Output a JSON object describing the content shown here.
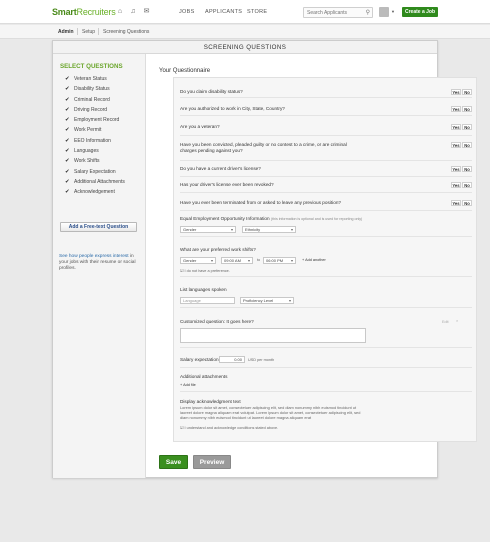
{
  "brand": {
    "part1": "Smart",
    "part2": "Recruiters",
    "accent": "#6bb12a",
    "dark_accent": "#2f8a1c"
  },
  "nav": {
    "icons": [
      "home-icon",
      "bell-icon",
      "mail-icon"
    ],
    "links": [
      "JOBS",
      "APPLICANTS",
      "STORE"
    ],
    "search_placeholder": "Search Applicants",
    "create_label": "Create a Job"
  },
  "subnav": {
    "admin": "Admin",
    "setup": "Setup",
    "screening": "Screening Questions"
  },
  "card": {
    "title": "SCREENING QUESTIONS"
  },
  "sidebar": {
    "title": "SELECT QUESTIONS",
    "items": [
      "Veteran Status",
      "Disability Status",
      "Criminal Record",
      "Driving Record",
      "Employment Record",
      "Work Permit",
      "EEO Information",
      "Languages",
      "Work Shifts",
      "Salary Expectation",
      "Additional Attachments",
      "Acknowledgement"
    ],
    "add_free_text": "Add a Free-text Question",
    "note_link": "See how people express interest",
    "note_rest": " in your jobs with their resume or social profiles."
  },
  "content": {
    "title": "Your Questionnaire",
    "yes": "Yes",
    "no": "No",
    "questions": [
      "Do you claim disability status?",
      "Are you authorized to work in City, State, Country?",
      "Are you a veteran?",
      "Have you been convicted, pleaded guilty or no contest to a crime, or are criminal charges pending against you?",
      "Do you have a current driver's license?",
      "Has your driver's license ever been revoked?",
      "Have you ever been terminated from or asked to leave any previous position?"
    ],
    "eeo": {
      "label": "Equal Employment Opportunity Information",
      "hint": "(this information is optional and is used for reporting only)",
      "gender": "Gender",
      "ethnicity": "Ethnicity"
    },
    "shifts": {
      "label": "What are your preferred work shifts?",
      "gender": "Gender",
      "from": "09:00 AM",
      "to_label": "to",
      "to": "06:00 PM",
      "add": "+ Add another",
      "no_pref": "I do not have a preference."
    },
    "languages": {
      "label": "List languages spoken",
      "placeholder": "Language",
      "level": "Proficiency Level"
    },
    "custom": {
      "label": "Customized question: It goes here?",
      "edit": "Edit",
      "close": "×"
    },
    "salary": {
      "label": "Salary expectation",
      "value": "0.00",
      "suffix": "USD per month"
    },
    "attachments": {
      "label": "Additional attachments",
      "add": "+ Add file"
    },
    "ack": {
      "label": "Display acknowledgment text",
      "text": "Lorem ipsum dolor sit amet, consectetuer adipiscing elit, sed diam nonummy nibh euismod tincidunt ut laoreet dolore magna aliquam erat volutpat. Lorem ipsum dolor sit amet, consectetuer adipiscing elit, sed diam nonummy nibh euismod tincidunt ut laoreet dolore magna aliquam erat",
      "agree": "I understand and acknowledge conditions stated above."
    }
  },
  "actions": {
    "save": "Save",
    "preview": "Preview"
  }
}
